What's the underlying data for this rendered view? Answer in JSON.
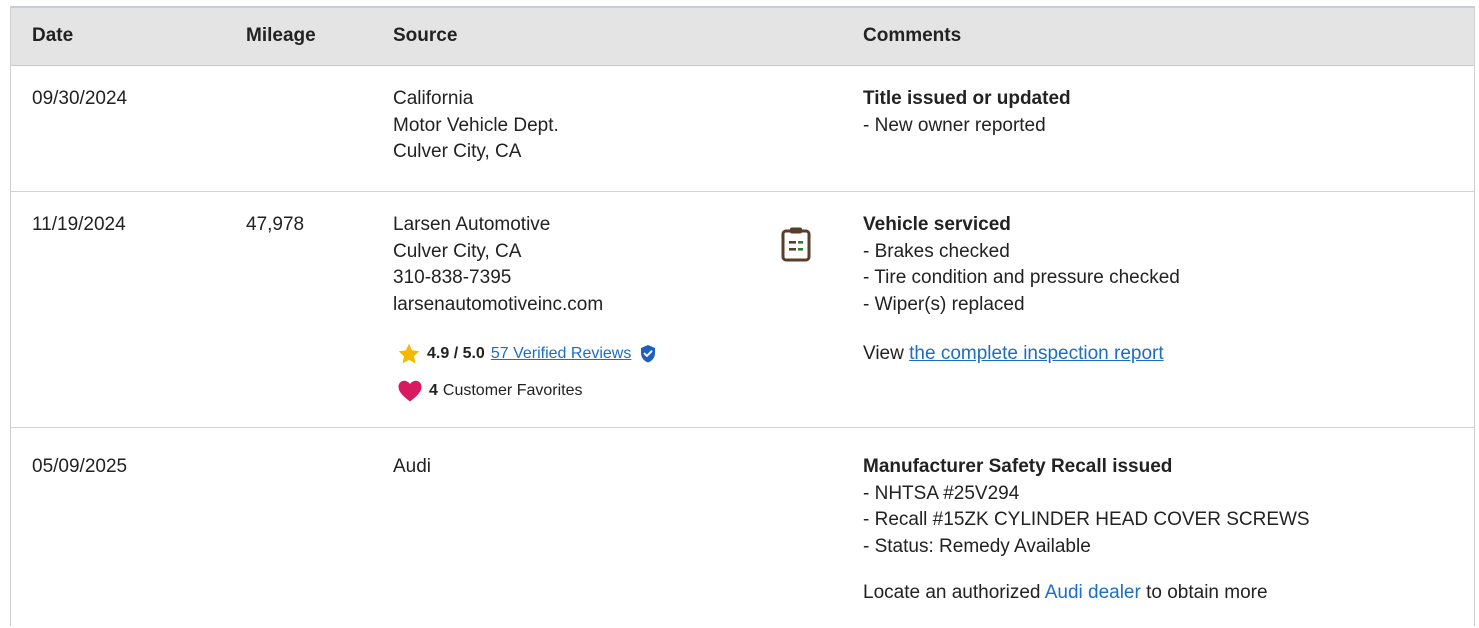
{
  "table": {
    "columns": [
      "Date",
      "Mileage",
      "Source",
      "Comments"
    ]
  },
  "rows": [
    {
      "date": "09/30/2024",
      "mileage": "",
      "source": [
        "California",
        "Motor Vehicle Dept.",
        "Culver City, CA"
      ],
      "comment_title": "Title issued or updated",
      "comment_lines": [
        "- New owner reported"
      ]
    },
    {
      "date": "11/19/2024",
      "mileage": "47,978",
      "source": [
        "Larsen Automotive",
        "Culver City, CA",
        "310-838-7395",
        "larsenautomotiveinc.com"
      ],
      "rating": "4.9 / 5.0",
      "reviews_link": "57 Verified Reviews",
      "favorites_count": "4",
      "favorites_label": "Customer Favorites",
      "comment_title": "Vehicle serviced",
      "comment_lines": [
        "- Brakes checked",
        "- Tire condition and pressure checked",
        "- Wiper(s) replaced"
      ],
      "view_prefix": "View",
      "view_link": "the complete inspection report"
    },
    {
      "date": "05/09/2025",
      "mileage": "",
      "source": [
        "Audi"
      ],
      "comment_title": "Manufacturer Safety Recall issued",
      "comment_lines": [
        "- NHTSA #25V294",
        "- Recall #15ZK CYLINDER HEAD COVER SCREWS",
        "- Status: Remedy Available"
      ],
      "locate_prefix": "Locate an authorized",
      "locate_link": "Audi dealer",
      "locate_suffix": "to obtain more"
    }
  ],
  "colors": {
    "header_bg": "#e4e4e4",
    "link": "#1b6ec2",
    "star": "#f5b800",
    "heart": "#d81b60",
    "verified": "#1f5fbf",
    "clipboard": "#5a3e2b",
    "clipboard_accent": "#2e7d32"
  },
  "icons": [
    "clipboard-icon",
    "star-icon",
    "verified-badge-icon",
    "heart-icon"
  ]
}
